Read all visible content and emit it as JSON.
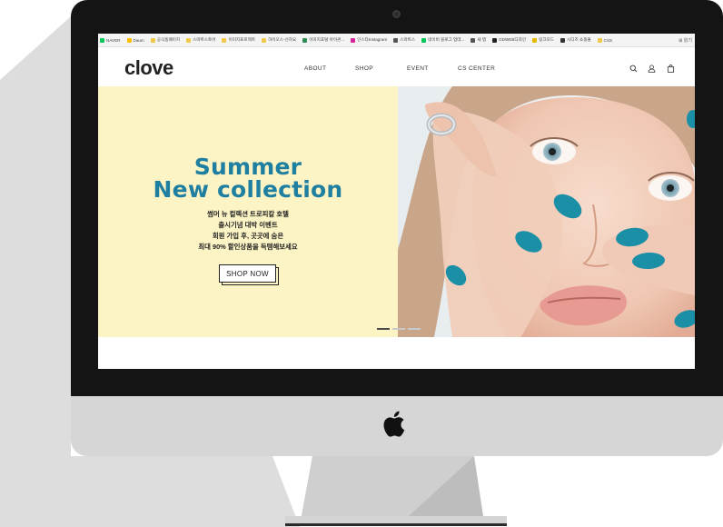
{
  "browser": {
    "bookmarks": [
      {
        "label": "NAVER",
        "icon": "naver-icon",
        "color": "#03c75a"
      },
      {
        "label": "Daum",
        "icon": "daum-icon",
        "color": "#ffbf00"
      },
      {
        "label": "공식홈페이지",
        "icon": "folder-icon",
        "color": "#f2c84b"
      },
      {
        "label": "스마트스토어",
        "icon": "folder-icon",
        "color": "#f2c84b"
      },
      {
        "label": "이미지프로젝트",
        "icon": "folder-icon",
        "color": "#f2c84b"
      },
      {
        "label": "하이오스-선하요",
        "icon": "folder-icon",
        "color": "#f2c84b"
      },
      {
        "label": "이미지포털 아이콘...",
        "icon": "globe-icon",
        "color": "#2e8b57"
      },
      {
        "label": "인스타Instagram",
        "icon": "instagram-icon",
        "color": "#d6249f"
      },
      {
        "label": "스마트스",
        "icon": "globe-icon",
        "color": "#555555"
      },
      {
        "label": "네이버 블로그 업데...",
        "icon": "naver-icon",
        "color": "#03c75a"
      },
      {
        "label": "새 탭",
        "icon": "globe-icon",
        "color": "#555555"
      },
      {
        "label": "GDWEB디자인",
        "icon": "gdweb-icon",
        "color": "#222222"
      },
      {
        "label": "링크모드",
        "icon": "link-icon",
        "color": "#e6b800"
      },
      {
        "label": "시디즈 쇼핑몰",
        "icon": "shop-icon",
        "color": "#333333"
      },
      {
        "label": "CSS",
        "icon": "folder-icon",
        "color": "#f2c84b"
      }
    ],
    "more_label": "⊞ 읽기"
  },
  "header": {
    "logo": "clove",
    "nav": [
      "ABOUT",
      "SHOP",
      "EVENT",
      "CS CENTER"
    ],
    "icons": [
      "search-icon",
      "user-icon",
      "shopping-bag-icon"
    ]
  },
  "hero": {
    "title_line1": "Summer",
    "title_line2": "New collection",
    "sub_line1": "썸머 뉴 컬렉션 트로피칼 호텔",
    "sub_line2": "출시기념  대박 이벤트",
    "sub_line3": "회원 가입 후, 곳곳에 숨은",
    "sub_line4": "최대 90% 할인상품을 득템해보세요",
    "cta": "SHOP NOW",
    "slides_total": 3,
    "slide_active": 1
  },
  "colors": {
    "accent": "#1f7fa0",
    "hero_bg": "#fdf4c6",
    "nail_polish": "#1a8fa6"
  }
}
